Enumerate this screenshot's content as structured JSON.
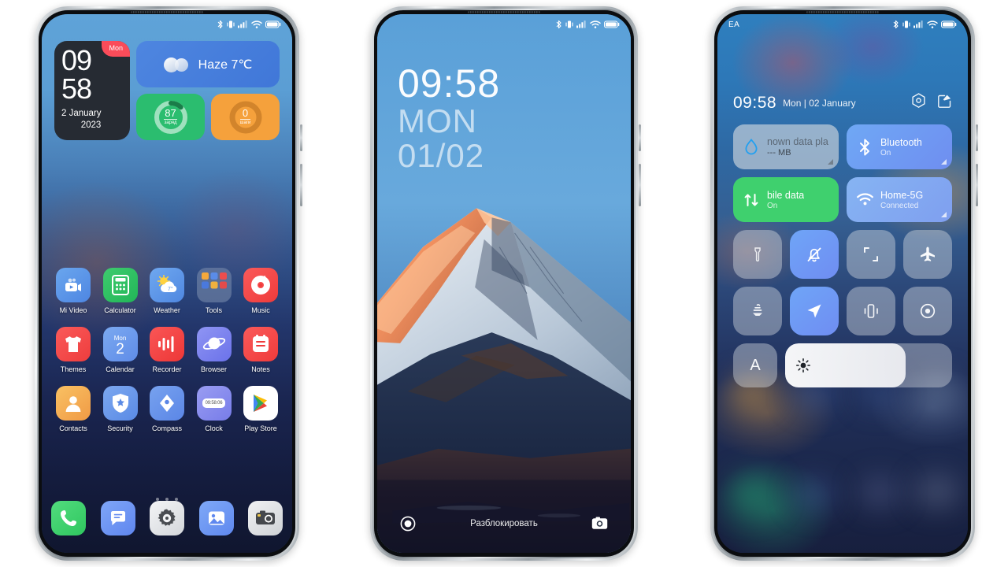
{
  "phone1": {
    "name": "home-screen",
    "status_bar": {
      "icons": [
        "bluetooth-icon",
        "vibrate-icon",
        "signal-icon",
        "wifi-icon",
        "battery-icon"
      ]
    },
    "clock_widget": {
      "hours": "09",
      "minutes": "58",
      "date": "2 January",
      "year": "2023",
      "day_badge": "Mon"
    },
    "weather_widget": {
      "label": "Haze 7℃",
      "icon": "haze-icon"
    },
    "battery_widget": {
      "value": "87",
      "label": "заряд",
      "percent": 87,
      "color": "#2bbd6f"
    },
    "steps_widget": {
      "value": "0",
      "label": "шаги",
      "percent": 0,
      "color": "#f5a13c"
    },
    "apps_row1": [
      {
        "label": "Mi Video",
        "icon": "mi-video-icon"
      },
      {
        "label": "Calculator",
        "icon": "calculator-icon"
      },
      {
        "label": "Weather",
        "icon": "weather-icon"
      },
      {
        "label": "Tools",
        "icon": "tools-folder-icon"
      },
      {
        "label": "Music",
        "icon": "music-icon"
      }
    ],
    "apps_row2": [
      {
        "label": "Themes",
        "icon": "themes-icon"
      },
      {
        "label": "Calendar",
        "icon": "calendar-icon",
        "day_name": "Mon",
        "day_num": "2"
      },
      {
        "label": "Recorder",
        "icon": "recorder-icon"
      },
      {
        "label": "Browser",
        "icon": "browser-icon"
      },
      {
        "label": "Notes",
        "icon": "notes-icon"
      }
    ],
    "apps_row3": [
      {
        "label": "Contacts",
        "icon": "contacts-icon"
      },
      {
        "label": "Security",
        "icon": "security-icon"
      },
      {
        "label": "Compass",
        "icon": "compass-icon"
      },
      {
        "label": "Clock",
        "icon": "clock-icon",
        "display": "09:58:06"
      },
      {
        "label": "Play Store",
        "icon": "play-store-icon"
      }
    ],
    "dock": [
      {
        "label": "Phone",
        "icon": "phone-icon"
      },
      {
        "label": "Messages",
        "icon": "messages-icon"
      },
      {
        "label": "Settings",
        "icon": "settings-gear-icon"
      },
      {
        "label": "Gallery",
        "icon": "gallery-icon"
      },
      {
        "label": "Camera",
        "icon": "camera-icon"
      }
    ],
    "page_dots": 3
  },
  "phone2": {
    "name": "lock-screen",
    "status_bar": {
      "icons": [
        "bluetooth-icon",
        "vibrate-icon",
        "signal-icon",
        "wifi-icon",
        "battery-icon"
      ]
    },
    "time": "09:58",
    "weekday": "MON",
    "date": "01/02",
    "unlock_hint": "Разблокировать",
    "left_button": "record-icon",
    "right_button": "camera-icon",
    "wallpaper": "mount-fuji-sunset"
  },
  "phone3": {
    "name": "control-center",
    "status_bar": {
      "carrier": "EA",
      "icons": [
        "bluetooth-icon",
        "vibrate-icon",
        "signal-icon",
        "wifi-icon",
        "battery-icon"
      ]
    },
    "time": "09:58",
    "date": "Mon | 02 January",
    "header_icons": [
      "settings-hex-icon",
      "edit-icon"
    ],
    "big_tiles": [
      {
        "title": "nown data pla",
        "subtitle": "--- MB",
        "icon": "data-drop-icon",
        "style": "grey"
      },
      {
        "title": "Bluetooth",
        "subtitle": "On",
        "icon": "bluetooth-icon",
        "style": "blue"
      },
      {
        "title": "bile data",
        "subtitle": "On",
        "icon": "mobile-data-icon",
        "style": "green"
      },
      {
        "title": "Home-5G",
        "subtitle": "Connected",
        "icon": "wifi-icon",
        "style": "wifi"
      }
    ],
    "toggle_row1": [
      {
        "icon": "flashlight-icon",
        "on": false
      },
      {
        "icon": "silent-bell-icon",
        "on": true
      },
      {
        "icon": "screenshot-icon",
        "on": false
      },
      {
        "icon": "airplane-icon",
        "on": false
      }
    ],
    "toggle_row2": [
      {
        "icon": "cast-icon",
        "on": false
      },
      {
        "icon": "location-icon",
        "on": true
      },
      {
        "icon": "vibrate-phone-icon",
        "on": false
      },
      {
        "icon": "record-screen-icon",
        "on": false
      }
    ],
    "auto_brightness": {
      "label": "A",
      "on": false
    },
    "brightness_slider": {
      "icon": "brightness-icon",
      "percent": 72
    }
  }
}
